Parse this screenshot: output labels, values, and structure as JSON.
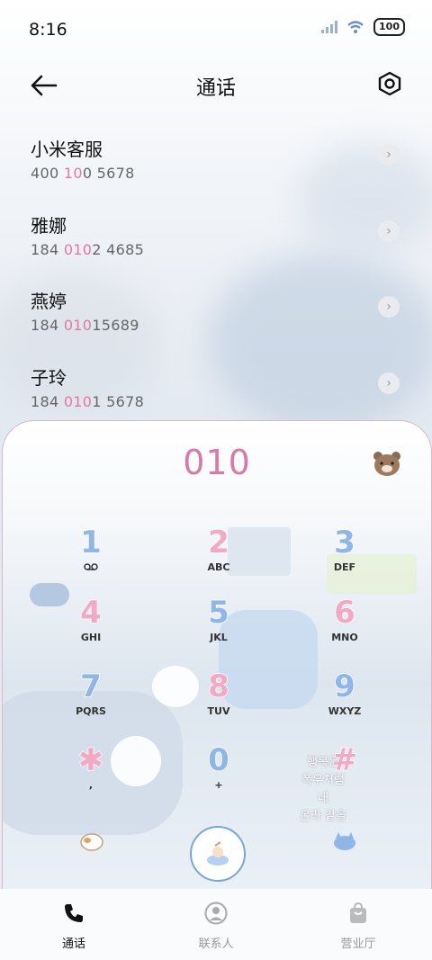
{
  "status": {
    "time": "8:16",
    "battery": "100"
  },
  "header": {
    "title": "通话",
    "back_icon": "arrow-left-icon",
    "settings_icon": "gear-icon"
  },
  "contacts": [
    {
      "name": "小米客服",
      "num_parts": [
        "40",
        "0 ",
        "10",
        "0 5678"
      ]
    },
    {
      "name": "雅娜",
      "num_parts": [
        "184 ",
        "",
        "010",
        "2 4685"
      ]
    },
    {
      "name": "燕婷",
      "num_parts": [
        "184 ",
        "",
        "010",
        "15689"
      ]
    },
    {
      "name": "子玲",
      "num_parts": [
        "184 ",
        "",
        "010",
        "1 5678"
      ]
    }
  ],
  "dialer": {
    "input": "010",
    "keys": [
      {
        "digit": "1",
        "letters": "",
        "color": "#8fb6e6"
      },
      {
        "digit": "2",
        "letters": "ABC",
        "color": "#f2a9c4"
      },
      {
        "digit": "3",
        "letters": "DEF",
        "color": "#8fb6e6"
      },
      {
        "digit": "4",
        "letters": "GHI",
        "color": "#f2a9c4"
      },
      {
        "digit": "5",
        "letters": "JKL",
        "color": "#8fb6e6"
      },
      {
        "digit": "6",
        "letters": "MNO",
        "color": "#f2a9c4"
      },
      {
        "digit": "7",
        "letters": "PQRS",
        "color": "#8fb6e6"
      },
      {
        "digit": "8",
        "letters": "TUV",
        "color": "#f2a9c4"
      },
      {
        "digit": "9",
        "letters": "WXYZ",
        "color": "#8fb6e6"
      },
      {
        "digit": "✱",
        "letters": ",",
        "color": "#f2a9c4"
      },
      {
        "digit": "0",
        "letters": "+",
        "color": "#8fb6e6"
      },
      {
        "digit": "#",
        "letters": "",
        "color": "#f2a9c4"
      }
    ],
    "deco_text": [
      "행복은",
      "폭우처럼",
      "내",
      "온라 같을"
    ]
  },
  "tabs": [
    {
      "label": "通话",
      "icon": "phone-icon"
    },
    {
      "label": "联系人",
      "icon": "person-icon"
    },
    {
      "label": "营业厅",
      "icon": "shopping-bag-icon"
    }
  ]
}
